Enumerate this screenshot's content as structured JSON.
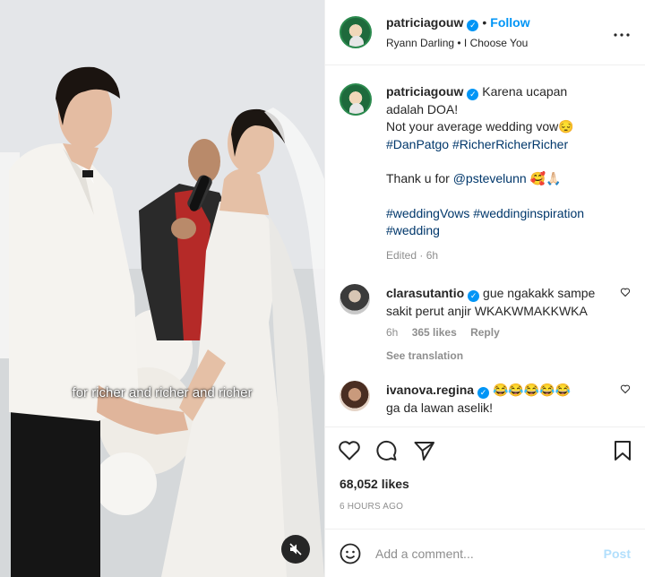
{
  "media": {
    "caption": "for richer and richer and richer"
  },
  "header": {
    "username": "patriciagouw",
    "follow": "Follow",
    "music": "Ryann Darling • I Choose You",
    "verified_mark": "✓",
    "dot": "•"
  },
  "post": {
    "username": "patriciagouw",
    "line1": "Karena ucapan",
    "line2": "adalah DOA!",
    "line3": "Not your average wedding vow😔",
    "tag1": "#DanPatgo",
    "tag2": "#RicherRicherRicher",
    "thanks_prefix": "Thank u for",
    "mention": "@pstevelunn",
    "thanks_emoji": "🥰🙏🏻",
    "tag3": "#weddingVows",
    "tag4": "#weddinginspiration",
    "tag5": "#wedding",
    "edited": "Edited · 6h"
  },
  "comments": [
    {
      "username": "clarasutantio",
      "text": "gue ngakakk sampe sakit perut anjir WKAKWMAKKWKA",
      "time": "6h",
      "likes": "365 likes",
      "reply": "Reply",
      "see_translation": "See translation"
    },
    {
      "username": "ivanova.regina",
      "emoji": "😂😂😂😂😂",
      "text": "ga da lawan aselik!"
    }
  ],
  "likes": "68,052 likes",
  "time": "6 HOURS AGO",
  "add_comment": {
    "placeholder": "Add a comment...",
    "post": "Post"
  },
  "icons": {
    "more": "more-options-icon",
    "heart": "heart-icon",
    "comment": "comment-icon",
    "share": "share-icon",
    "save": "bookmark-icon",
    "emoji": "emoji-icon",
    "mute": "muted-speaker-icon"
  },
  "colors": {
    "accent": "#0095f6",
    "hashtag": "#00376b",
    "muted": "#8e8e8e"
  }
}
